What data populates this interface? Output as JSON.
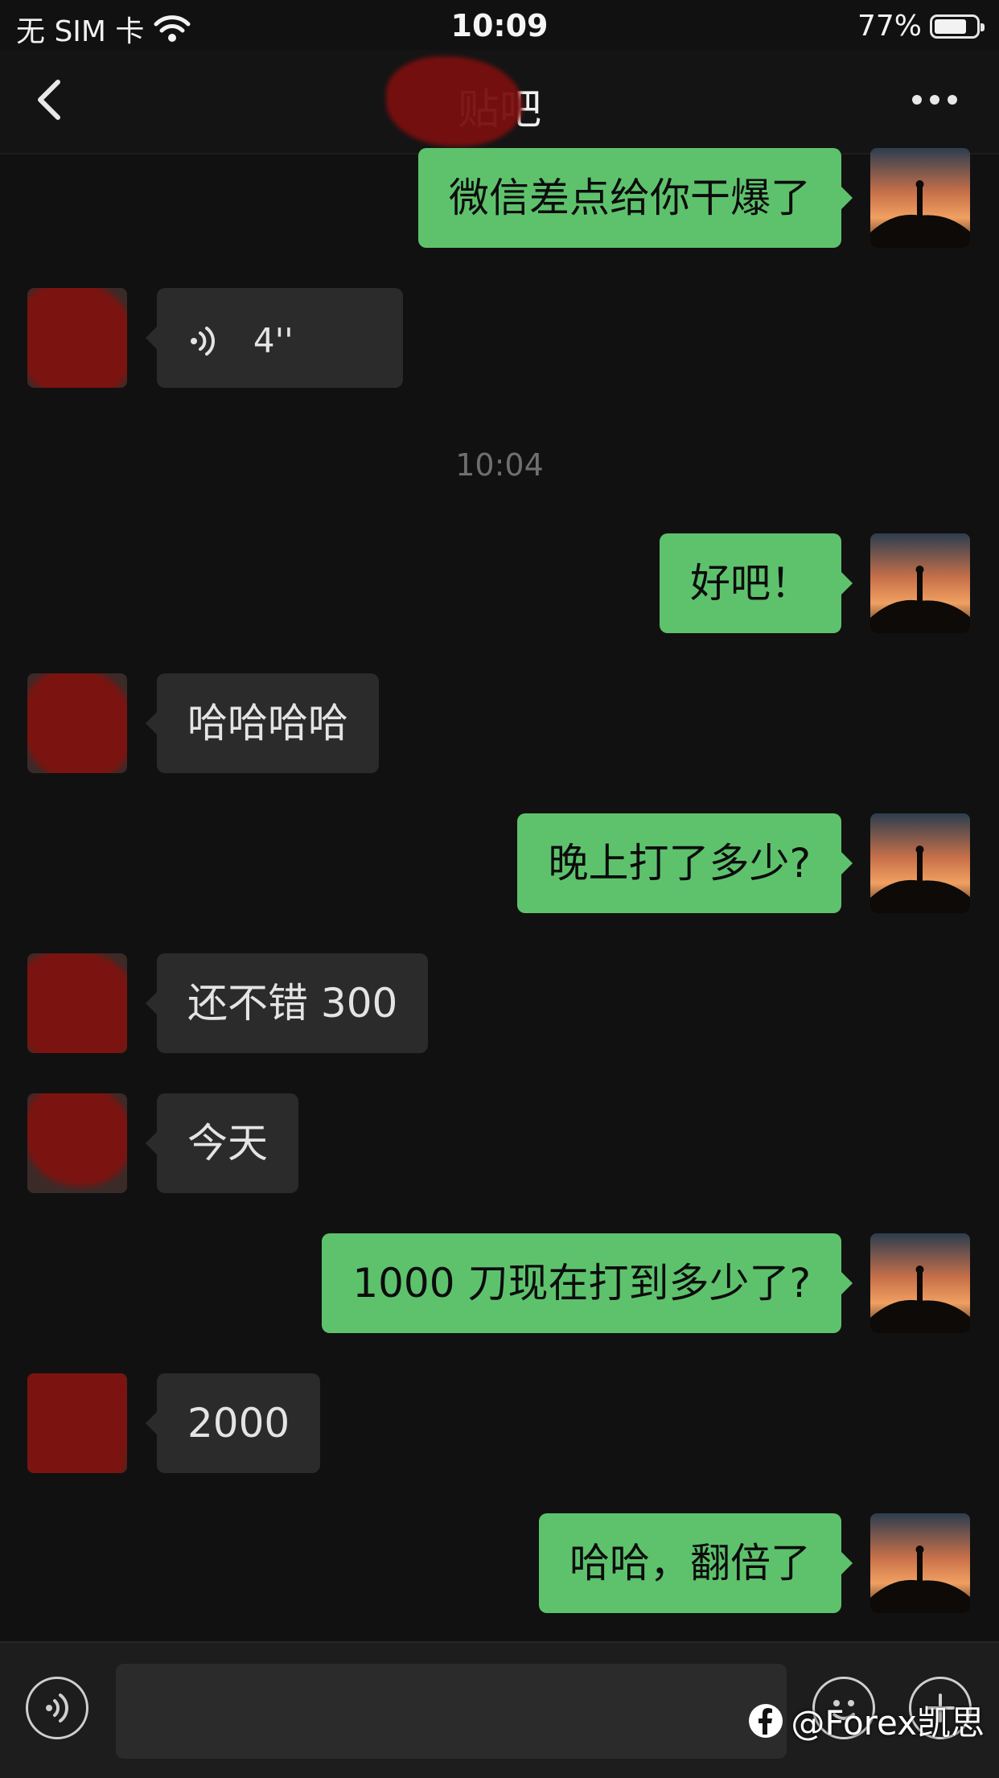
{
  "status_bar": {
    "carrier": "无 SIM 卡",
    "time": "10:09",
    "battery_percent": "77%",
    "battery_level": 0.77
  },
  "nav": {
    "title": "贴吧",
    "back_icon": "chevron-left-icon",
    "more_icon": "more-dots-icon"
  },
  "messages": [
    {
      "from": "me",
      "type": "text",
      "text": "微信差点给你干爆了"
    },
    {
      "from": "them",
      "type": "voice",
      "duration": "4''"
    },
    {
      "from": "me",
      "type": "text",
      "text": "好吧！"
    },
    {
      "from": "them",
      "type": "text",
      "text": "哈哈哈哈"
    },
    {
      "from": "me",
      "type": "text",
      "text": "晚上打了多少?"
    },
    {
      "from": "them",
      "type": "text",
      "text": "还不错 300"
    },
    {
      "from": "them",
      "type": "text",
      "text": "今天"
    },
    {
      "from": "me",
      "type": "text",
      "text": "1000 刀现在打到多少了?"
    },
    {
      "from": "them",
      "type": "text",
      "text": "2000"
    },
    {
      "from": "me",
      "type": "text",
      "text": "哈哈，翻倍了"
    }
  ],
  "timestamp": "10:04",
  "input_bar": {
    "voice_icon": "voice-icon",
    "emoji_icon": "emoji-icon",
    "plus_icon": "plus-icon",
    "input_value": ""
  },
  "watermark": {
    "text": "@Forex凯思",
    "icon": "facebook-icon"
  },
  "colors": {
    "background": "#111111",
    "my_bubble": "#5ec26d",
    "their_bubble": "#2b2b2b"
  }
}
